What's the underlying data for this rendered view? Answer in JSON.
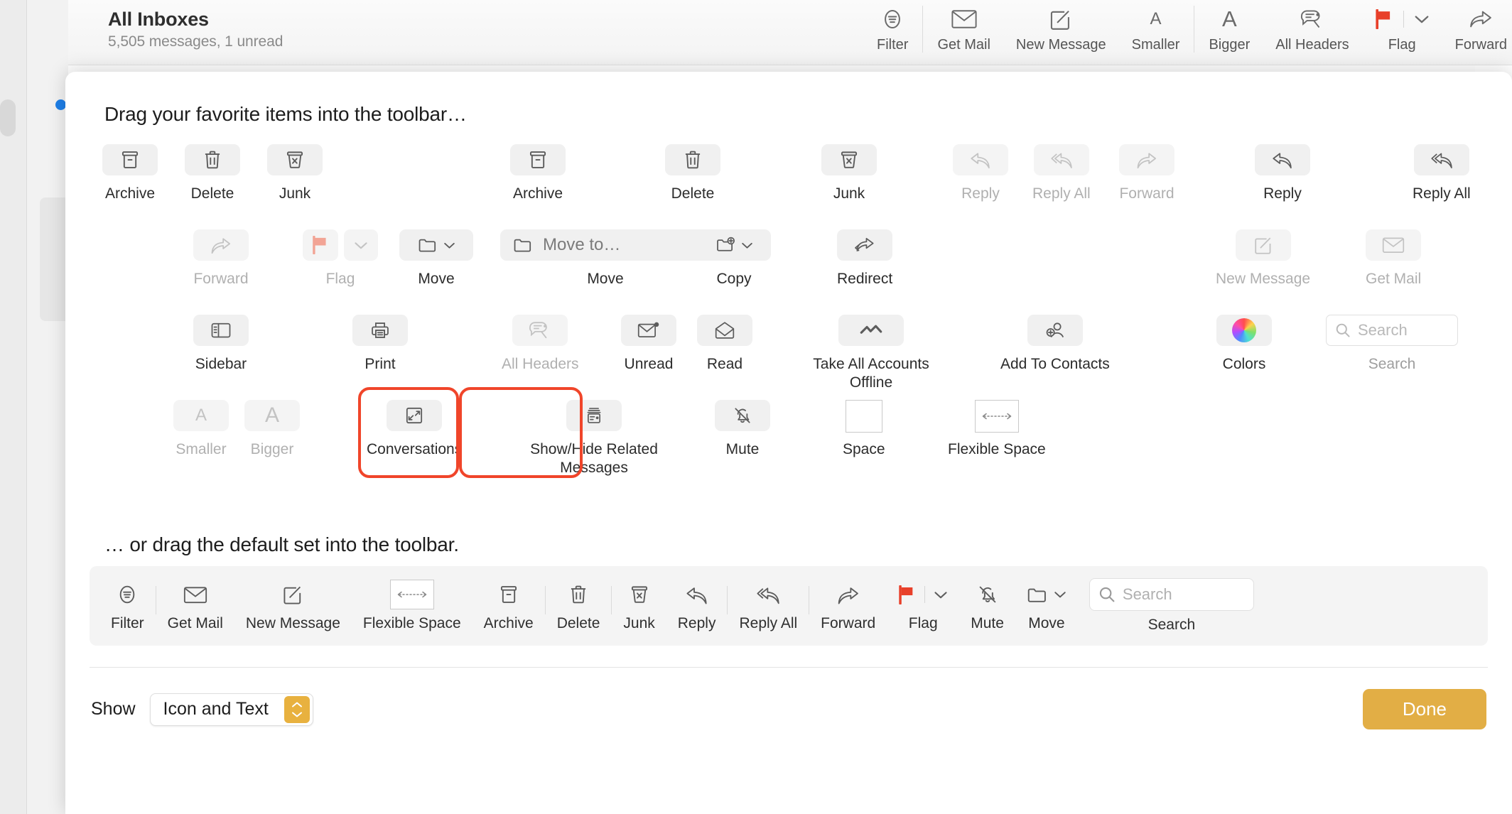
{
  "window": {
    "header": {
      "title": "All Inboxes",
      "subtitle": "5,505 messages, 1 unread"
    },
    "toolbar": [
      {
        "label": "Filter",
        "icon": "filter-icon"
      },
      {
        "label": "Get Mail",
        "icon": "envelope-icon"
      },
      {
        "label": "New Message",
        "icon": "compose-icon"
      },
      {
        "label": "Smaller",
        "icon": "text-smaller-icon"
      },
      {
        "label": "Bigger",
        "icon": "text-bigger-icon"
      },
      {
        "label": "All Headers",
        "icon": "all-headers-icon"
      },
      {
        "label": "Flag",
        "icon": "flag-icon"
      },
      {
        "label": "Forward",
        "icon": "forward-icon"
      }
    ]
  },
  "sheet": {
    "heading_favorites": "Drag your favorite items into the toolbar…",
    "heading_default": "… or drag the default set into the toolbar.",
    "palette_rows": [
      [
        {
          "label": "Archive",
          "icon": "archive-icon",
          "disabled": false,
          "style": "sq"
        },
        {
          "label": "Delete",
          "icon": "trash-icon",
          "disabled": false,
          "style": "sq"
        },
        {
          "label": "Junk",
          "icon": "junk-icon",
          "disabled": false,
          "style": "sq"
        },
        {
          "label": "Archive",
          "icon": "archive-icon",
          "disabled": false,
          "style": "sq"
        },
        {
          "label": "Delete",
          "icon": "trash-icon",
          "disabled": false,
          "style": "sq"
        },
        {
          "label": "Junk",
          "icon": "junk-icon",
          "disabled": false,
          "style": "sq"
        },
        {
          "label": "Reply",
          "icon": "reply-icon",
          "disabled": true,
          "style": "sq"
        },
        {
          "label": "Reply All",
          "icon": "reply-all-icon",
          "disabled": true,
          "style": "sq"
        },
        {
          "label": "Forward",
          "icon": "forward-icon",
          "disabled": true,
          "style": "sq"
        },
        {
          "label": "Reply",
          "icon": "reply-icon",
          "disabled": false,
          "style": "sq"
        },
        {
          "label": "Reply All",
          "icon": "reply-all-icon",
          "disabled": false,
          "style": "sq"
        }
      ],
      [
        {
          "label": "Forward",
          "icon": "forward-icon",
          "disabled": true,
          "style": "sq"
        },
        {
          "label": "Flag",
          "icon": "flag-menu-icon",
          "disabled": true,
          "style": "flagpair"
        },
        {
          "label": "Move",
          "icon": "folder-menu-icon",
          "disabled": false,
          "style": "wide"
        },
        {
          "label": "Move",
          "icon": "folder-icon",
          "disabled": false,
          "style": "xwide",
          "chip_text": "Move to…"
        },
        {
          "label": "Copy",
          "icon": "copy-folder-menu-icon",
          "disabled": false,
          "style": "wide"
        },
        {
          "label": "Redirect",
          "icon": "redirect-icon",
          "disabled": false,
          "style": "sq"
        },
        {
          "label": "New Message",
          "icon": "compose-icon",
          "disabled": true,
          "style": "sq"
        },
        {
          "label": "Get Mail",
          "icon": "envelope-icon",
          "disabled": true,
          "style": "sq"
        }
      ],
      [
        {
          "label": "Sidebar",
          "icon": "sidebar-icon",
          "disabled": false,
          "style": "sq"
        },
        {
          "label": "Print",
          "icon": "printer-icon",
          "disabled": false,
          "style": "sq"
        },
        {
          "label": "All Headers",
          "icon": "all-headers-icon",
          "disabled": true,
          "style": "sq"
        },
        {
          "label": "Unread",
          "icon": "unread-icon",
          "disabled": false,
          "style": "sq"
        },
        {
          "label": "Read",
          "icon": "read-icon",
          "disabled": false,
          "style": "sq"
        },
        {
          "label": "Take All Accounts Offline",
          "icon": "offline-icon",
          "disabled": false,
          "style": "sq",
          "two_line": true
        },
        {
          "label": "Add To Contacts",
          "icon": "add-contact-icon",
          "disabled": false,
          "style": "sq"
        },
        {
          "label": "Colors",
          "icon": "color-wheel-icon",
          "disabled": false,
          "style": "sq"
        },
        {
          "label": "Search",
          "icon": "search-icon",
          "disabled": false,
          "style": "search",
          "placeholder": "Search"
        }
      ],
      [
        {
          "label": "Smaller",
          "icon": "text-smaller-icon",
          "disabled": true,
          "style": "sq"
        },
        {
          "label": "Bigger",
          "icon": "text-bigger-icon",
          "disabled": true,
          "style": "sq"
        },
        {
          "label": "Conversations",
          "icon": "conversations-icon",
          "disabled": false,
          "style": "sq",
          "highlighted": true
        },
        {
          "label": "Show/Hide Related Messages",
          "icon": "related-messages-icon",
          "disabled": false,
          "style": "sq",
          "highlighted": true,
          "two_line": true
        },
        {
          "label": "Mute",
          "icon": "mute-icon",
          "disabled": false,
          "style": "sq"
        },
        {
          "label": "Space",
          "icon": "space-icon",
          "disabled": false,
          "style": "space"
        },
        {
          "label": "Flexible Space",
          "icon": "flexible-space-icon",
          "disabled": false,
          "style": "flexspace"
        }
      ]
    ],
    "default_set": [
      {
        "label": "Filter",
        "icon": "filter-icon"
      },
      {
        "label": "Get Mail",
        "icon": "envelope-icon"
      },
      {
        "label": "New Message",
        "icon": "compose-icon"
      },
      {
        "label": "Flexible Space",
        "icon": "flexible-space-icon"
      },
      {
        "label": "Archive",
        "icon": "archive-icon"
      },
      {
        "label": "Delete",
        "icon": "trash-icon"
      },
      {
        "label": "Junk",
        "icon": "junk-icon"
      },
      {
        "label": "Reply",
        "icon": "reply-icon"
      },
      {
        "label": "Reply All",
        "icon": "reply-all-icon"
      },
      {
        "label": "Forward",
        "icon": "forward-icon"
      },
      {
        "label": "Flag",
        "icon": "flag-menu-icon"
      },
      {
        "label": "Mute",
        "icon": "mute-icon"
      },
      {
        "label": "Move",
        "icon": "folder-menu-icon"
      },
      {
        "label": "Search",
        "icon": "search-icon",
        "placeholder": "Search"
      }
    ],
    "footer": {
      "show_label": "Show",
      "show_value": "Icon and Text",
      "done_label": "Done"
    }
  },
  "colors": {
    "accent_gold": "#e2ae45",
    "annotation_red": "#f0452a",
    "flag_red": "#e8402a",
    "unread_blue": "#1e7fe8"
  }
}
